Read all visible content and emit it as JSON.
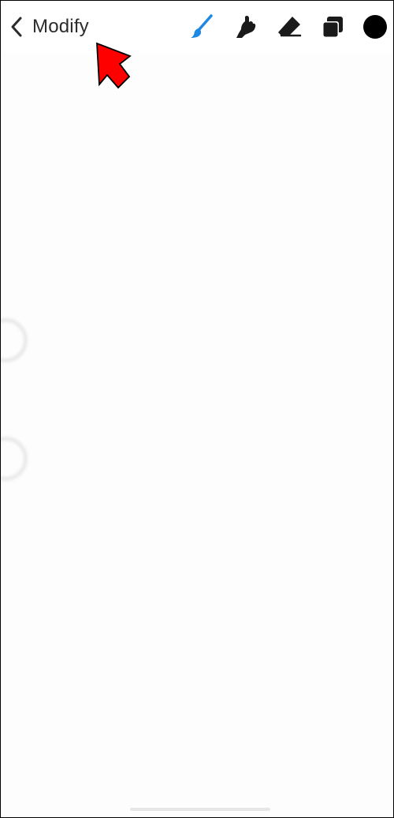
{
  "header": {
    "back_label": "Modify"
  },
  "toolbar": {
    "tools": [
      {
        "name": "brush",
        "icon": "brush-icon",
        "color": "#1e88e5"
      },
      {
        "name": "smudge",
        "icon": "smudge-icon",
        "color": "#1a1a1a"
      },
      {
        "name": "eraser",
        "icon": "eraser-icon",
        "color": "#1a1a1a"
      },
      {
        "name": "layers",
        "icon": "layers-icon",
        "color": "#1a1a1a"
      },
      {
        "name": "color",
        "icon": "color-swatch",
        "color": "#000000"
      }
    ],
    "active_tool": "brush"
  },
  "annotation": {
    "arrow_color": "#ff0000",
    "points_to": "back_label"
  }
}
